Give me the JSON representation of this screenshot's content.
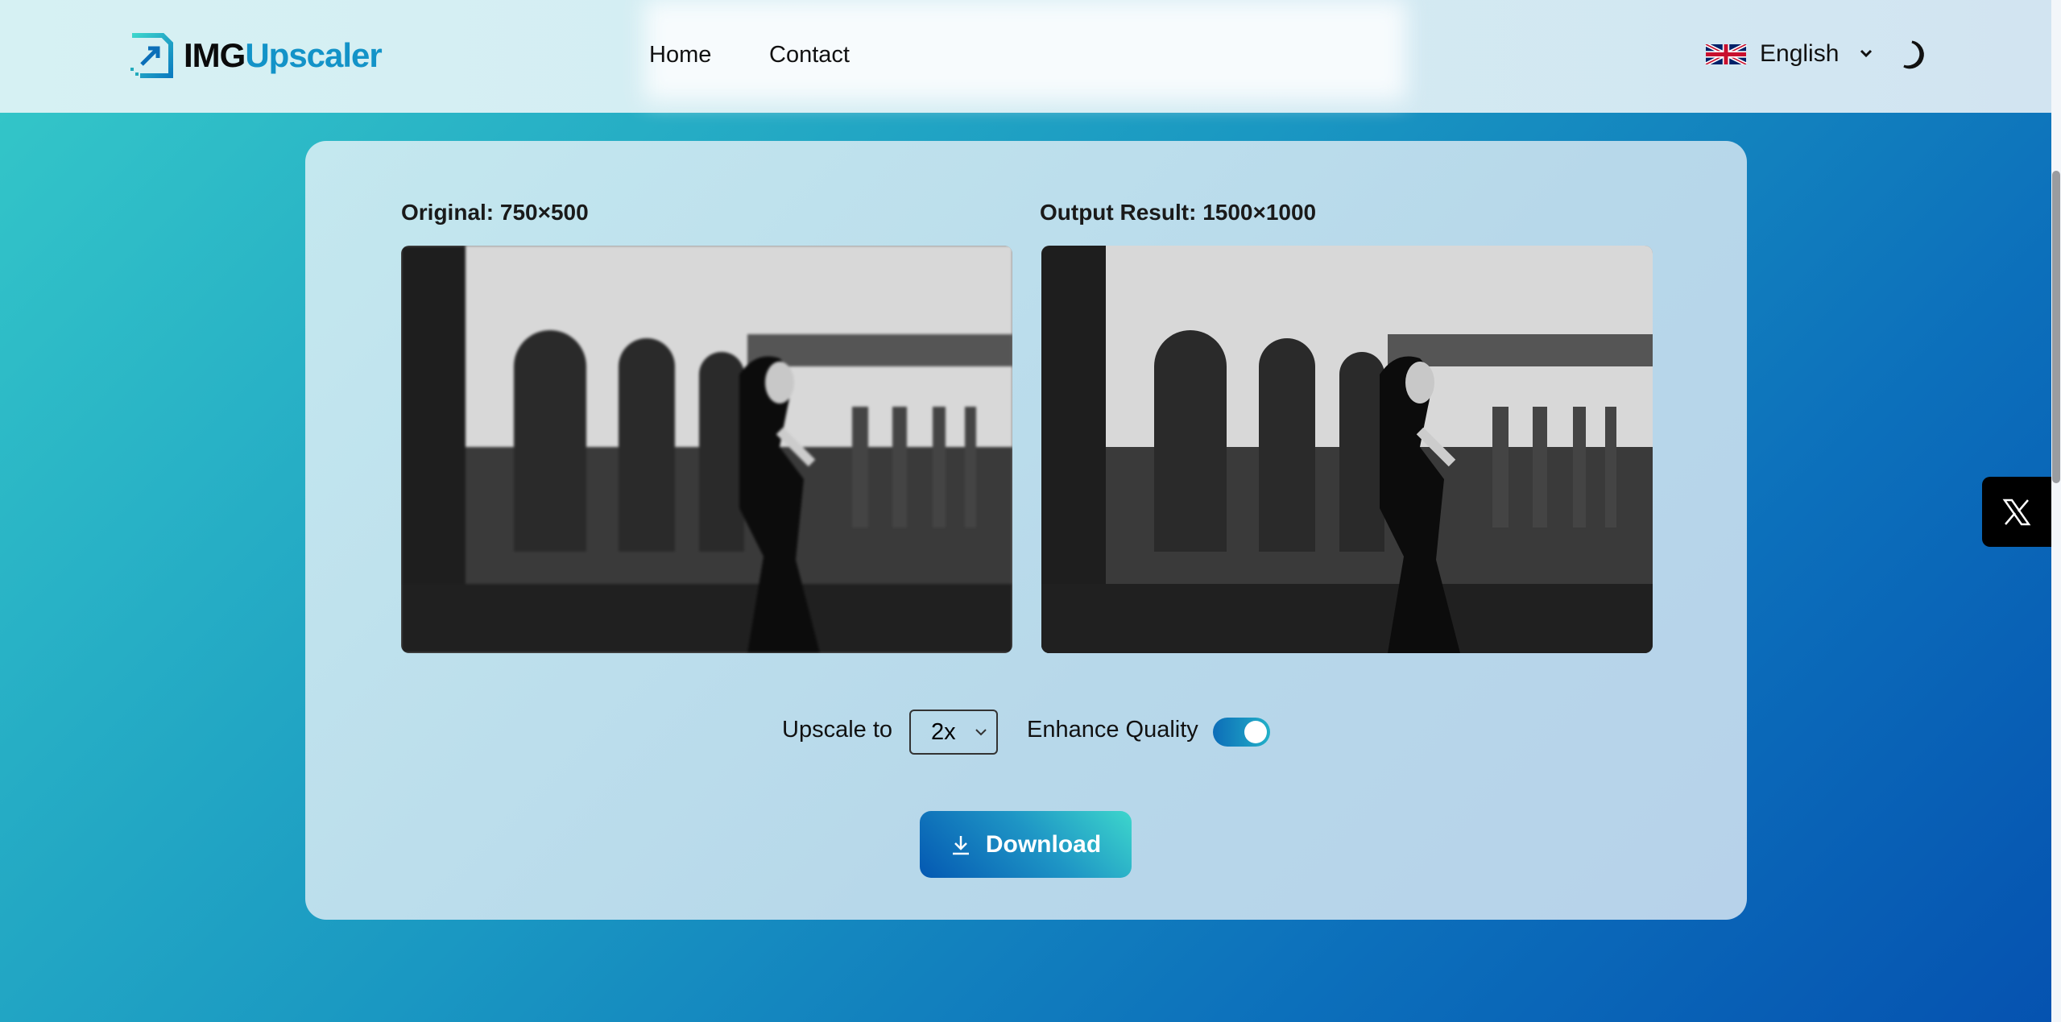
{
  "header": {
    "logo_part1": "IMG",
    "logo_part2": "Upscaler",
    "nav": [
      "Home",
      "Contact"
    ],
    "language": "English"
  },
  "main": {
    "original_label": "Original: 750×500",
    "output_label": "Output Result: 1500×1000",
    "upscale_label": "Upscale to",
    "upscale_value": "2x",
    "enhance_label": "Enhance Quality",
    "enhance_enabled": true,
    "download_label": "Download"
  },
  "colors": {
    "brand": "#1393c8",
    "button_start": "#0458b2",
    "button_end": "#3dd6cc"
  },
  "icons": [
    "logo-icon",
    "uk-flag-icon",
    "chevron-down-icon",
    "moon-icon",
    "download-icon",
    "x-logo-icon"
  ]
}
